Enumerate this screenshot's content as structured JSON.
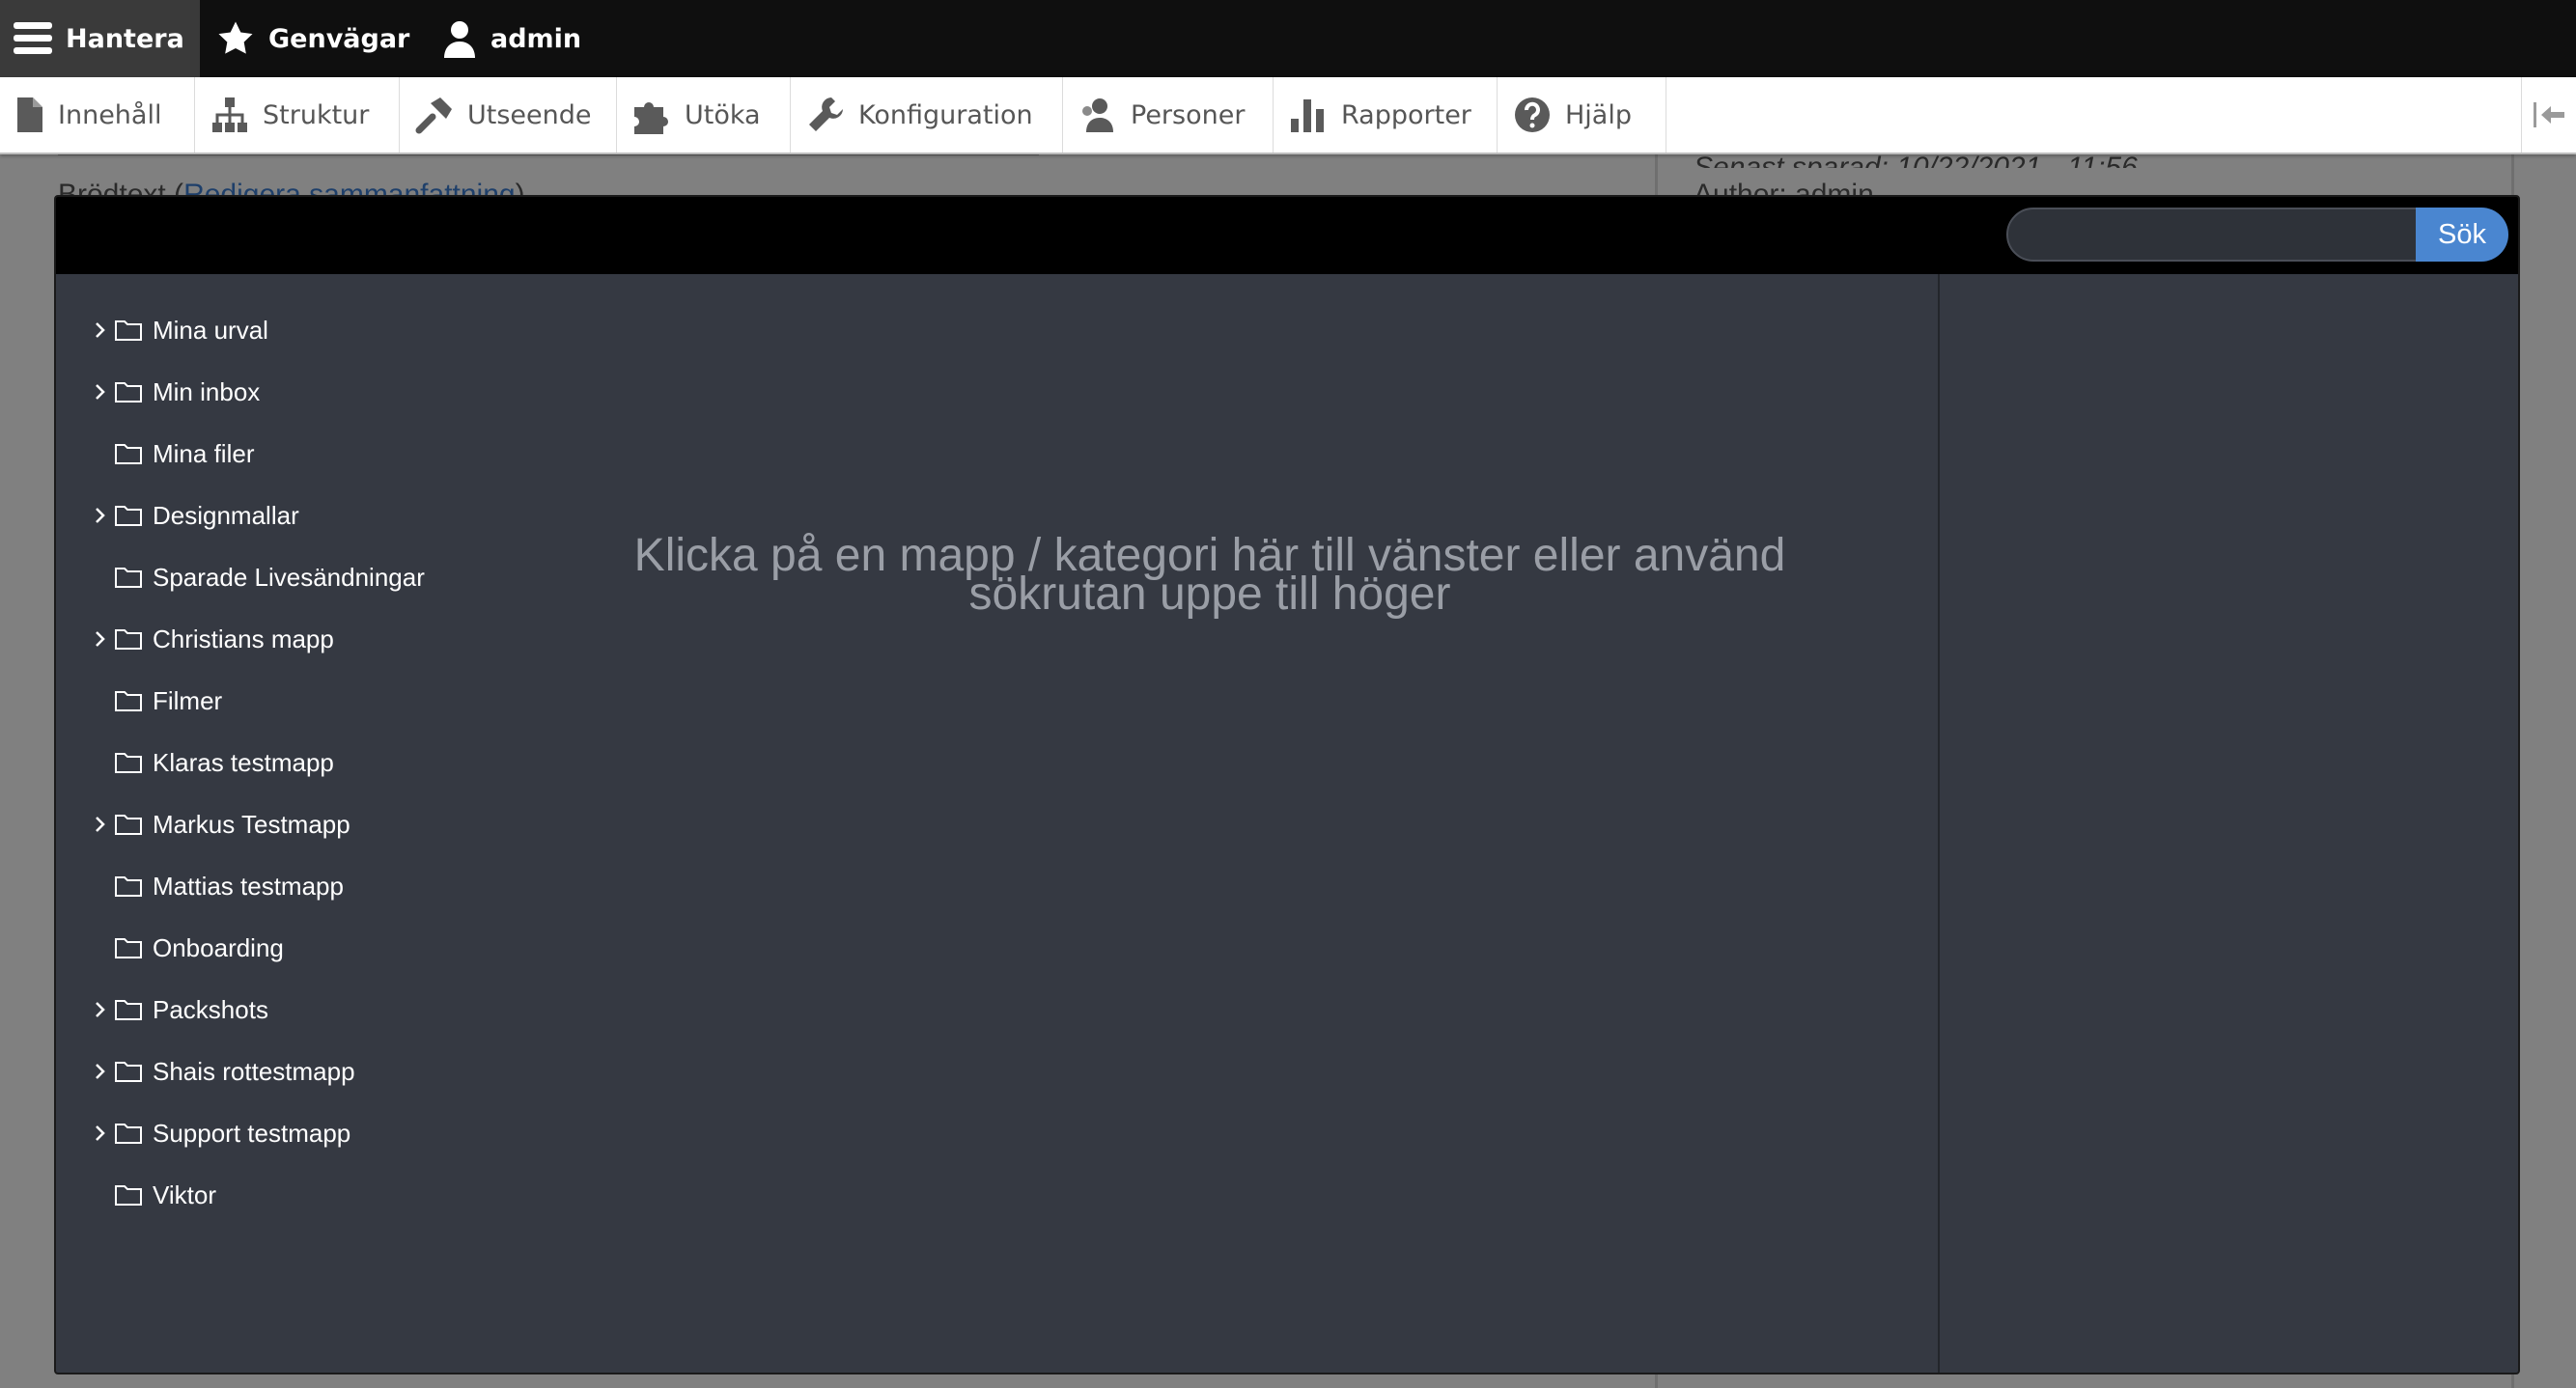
{
  "toolbar": {
    "manage_label": "Hantera",
    "shortcuts_label": "Genvägar",
    "user_label": "admin"
  },
  "tray": {
    "items": [
      {
        "label": "Innehåll",
        "icon": "document-icon"
      },
      {
        "label": "Struktur",
        "icon": "structure-icon"
      },
      {
        "label": "Utseende",
        "icon": "paintbrush-icon"
      },
      {
        "label": "Utöka",
        "icon": "puzzle-icon"
      },
      {
        "label": "Konfiguration",
        "icon": "wrench-icon"
      },
      {
        "label": "Personer",
        "icon": "people-icon"
      },
      {
        "label": "Rapporter",
        "icon": "bar-chart-icon"
      },
      {
        "label": "Hjälp",
        "icon": "help-icon"
      }
    ]
  },
  "background": {
    "left_text": "Brödtext (",
    "left_link": "Redigera sammanfattning",
    "left_close": ")",
    "right_line1": "Senast sparad: 10/22/2021 - 11:56",
    "right_line2": "Author: admin"
  },
  "browser": {
    "search": {
      "value": "",
      "placeholder": "",
      "button_label": "Sök"
    },
    "folders": [
      {
        "label": "Mina urval",
        "expandable": true
      },
      {
        "label": "Min inbox",
        "expandable": true
      },
      {
        "label": "Mina filer",
        "expandable": false
      },
      {
        "label": "Designmallar",
        "expandable": true
      },
      {
        "label": "Sparade Livesändningar",
        "expandable": false
      },
      {
        "label": "Christians mapp",
        "expandable": true
      },
      {
        "label": "Filmer",
        "expandable": false
      },
      {
        "label": "Klaras testmapp",
        "expandable": false
      },
      {
        "label": "Markus Testmapp",
        "expandable": true
      },
      {
        "label": "Mattias testmapp",
        "expandable": false
      },
      {
        "label": "Onboarding",
        "expandable": false
      },
      {
        "label": "Packshots",
        "expandable": true
      },
      {
        "label": "Shais rottestmapp",
        "expandable": true
      },
      {
        "label": "Support testmapp",
        "expandable": true
      },
      {
        "label": "Viktor",
        "expandable": false
      }
    ],
    "placeholder": "Klicka på en mapp / kategori här till vänster eller använd sökrutan uppe till höger"
  },
  "colors": {
    "toolbar_bg": "#0f0f0f",
    "modal_bg": "#353942",
    "search_button": "#4a86d0",
    "placeholder_text": "#9a9ea6"
  }
}
